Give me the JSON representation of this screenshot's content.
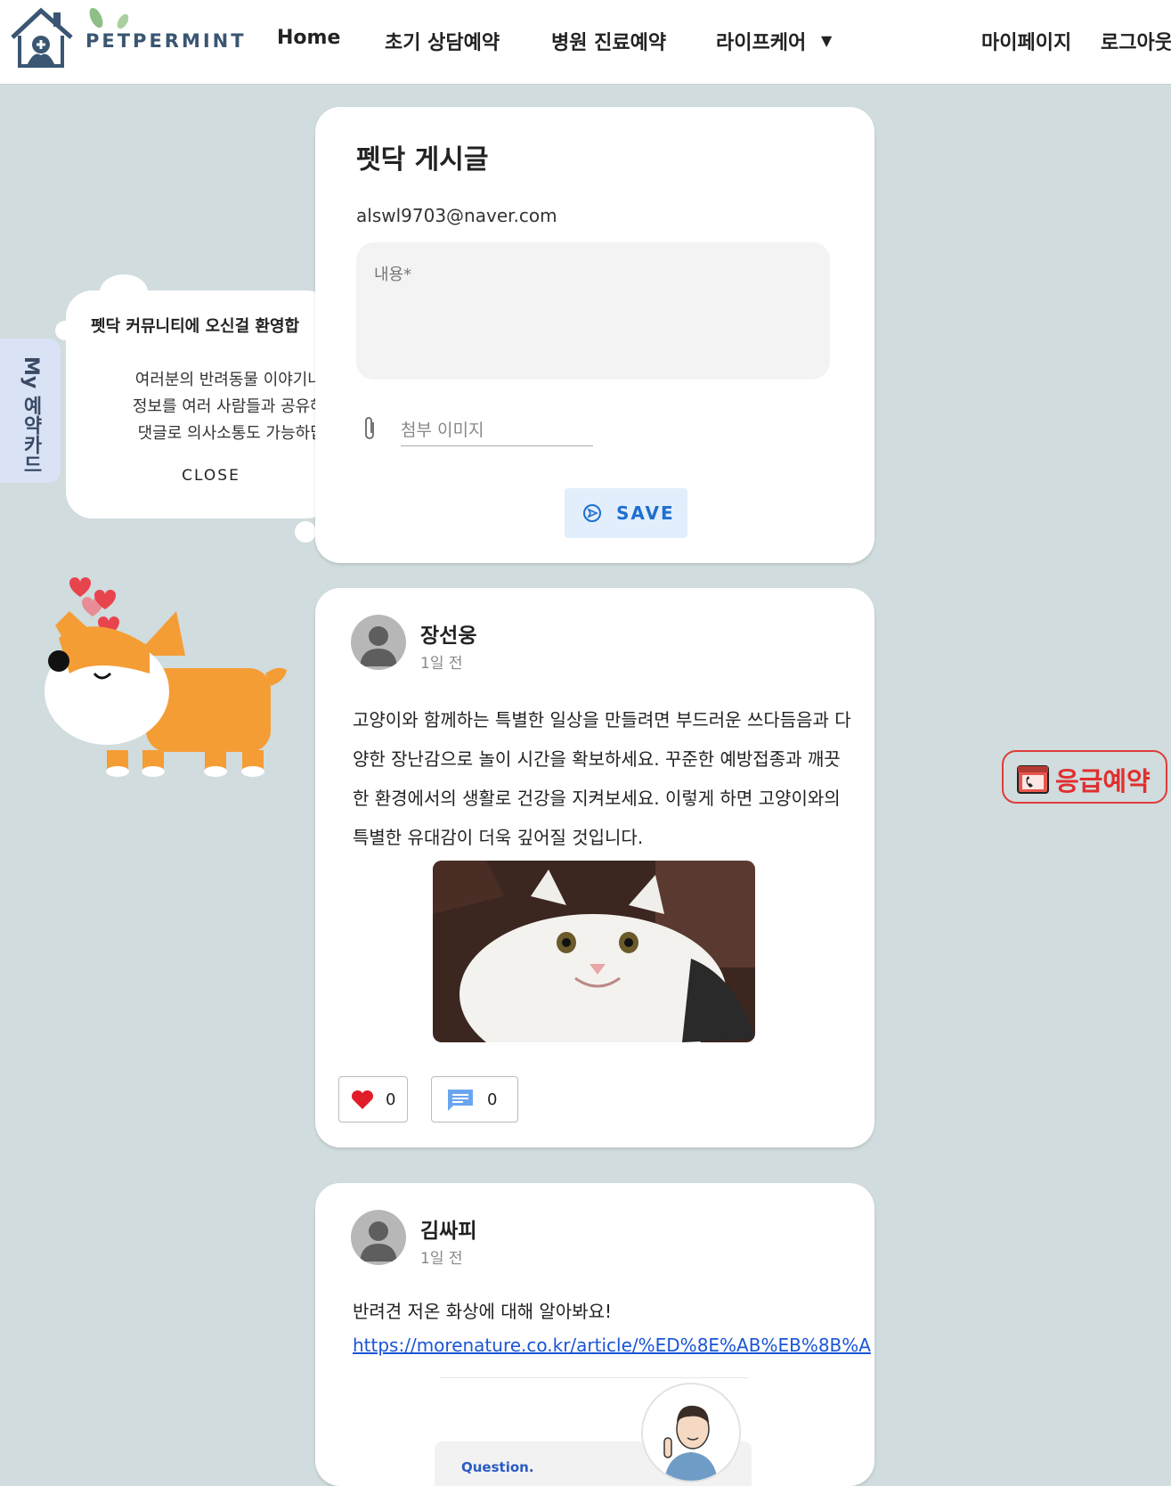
{
  "header": {
    "logo_text": "PETPERMINT",
    "nav": [
      "Home",
      "초기 상담예약",
      "병원 진료예약",
      "라이프케어"
    ],
    "dropdown_arrow": "▼",
    "right_links": [
      "마이페이지",
      "로그아웃"
    ]
  },
  "side_tab": {
    "label": "My 예약카드"
  },
  "welcome": {
    "title": "펫닥 커뮤니티에 오신걸 환영합",
    "lines": [
      "여러분의 반려동물 이야기나 유",
      "정보를 여러 사람들과 공유해 보",
      "댓글로 의사소통도 가능하답니"
    ],
    "close_label": "CLOSE"
  },
  "compose": {
    "title": "펫닥 게시글",
    "email": "alswl9703@naver.com",
    "content_placeholder": "내용*",
    "attach_placeholder": "첨부 이미지",
    "save_label": "SAVE"
  },
  "posts": [
    {
      "author": "장선웅",
      "time": "1일 전",
      "body": "고양이와 함께하는 특별한 일상을 만들려면 부드러운 쓰다듬음과 다양한 장난감으로 놀이 시간을 확보하세요. 꾸준한 예방접종과 깨끗한 환경에서의 생활로 건강을 지켜보세요. 이렇게 하면 고양이와의 특별한 유대감이 더욱 깊어질 것입니다.",
      "likes": "0",
      "comments": "0"
    },
    {
      "author": "김싸피",
      "time": "1일 전",
      "body": "반려견 저온 화상에 대해 알아봐요!",
      "link": "https://morenature.co.kr/article/%ED%8E%AB%EB%8B%A",
      "question_label": "Question."
    }
  ],
  "emergency": {
    "label": "응급예약"
  },
  "colors": {
    "background": "#d0dcdd",
    "accent": "#1e6fd0",
    "emergency": "#e12f2f",
    "like": "#e11d2a"
  }
}
